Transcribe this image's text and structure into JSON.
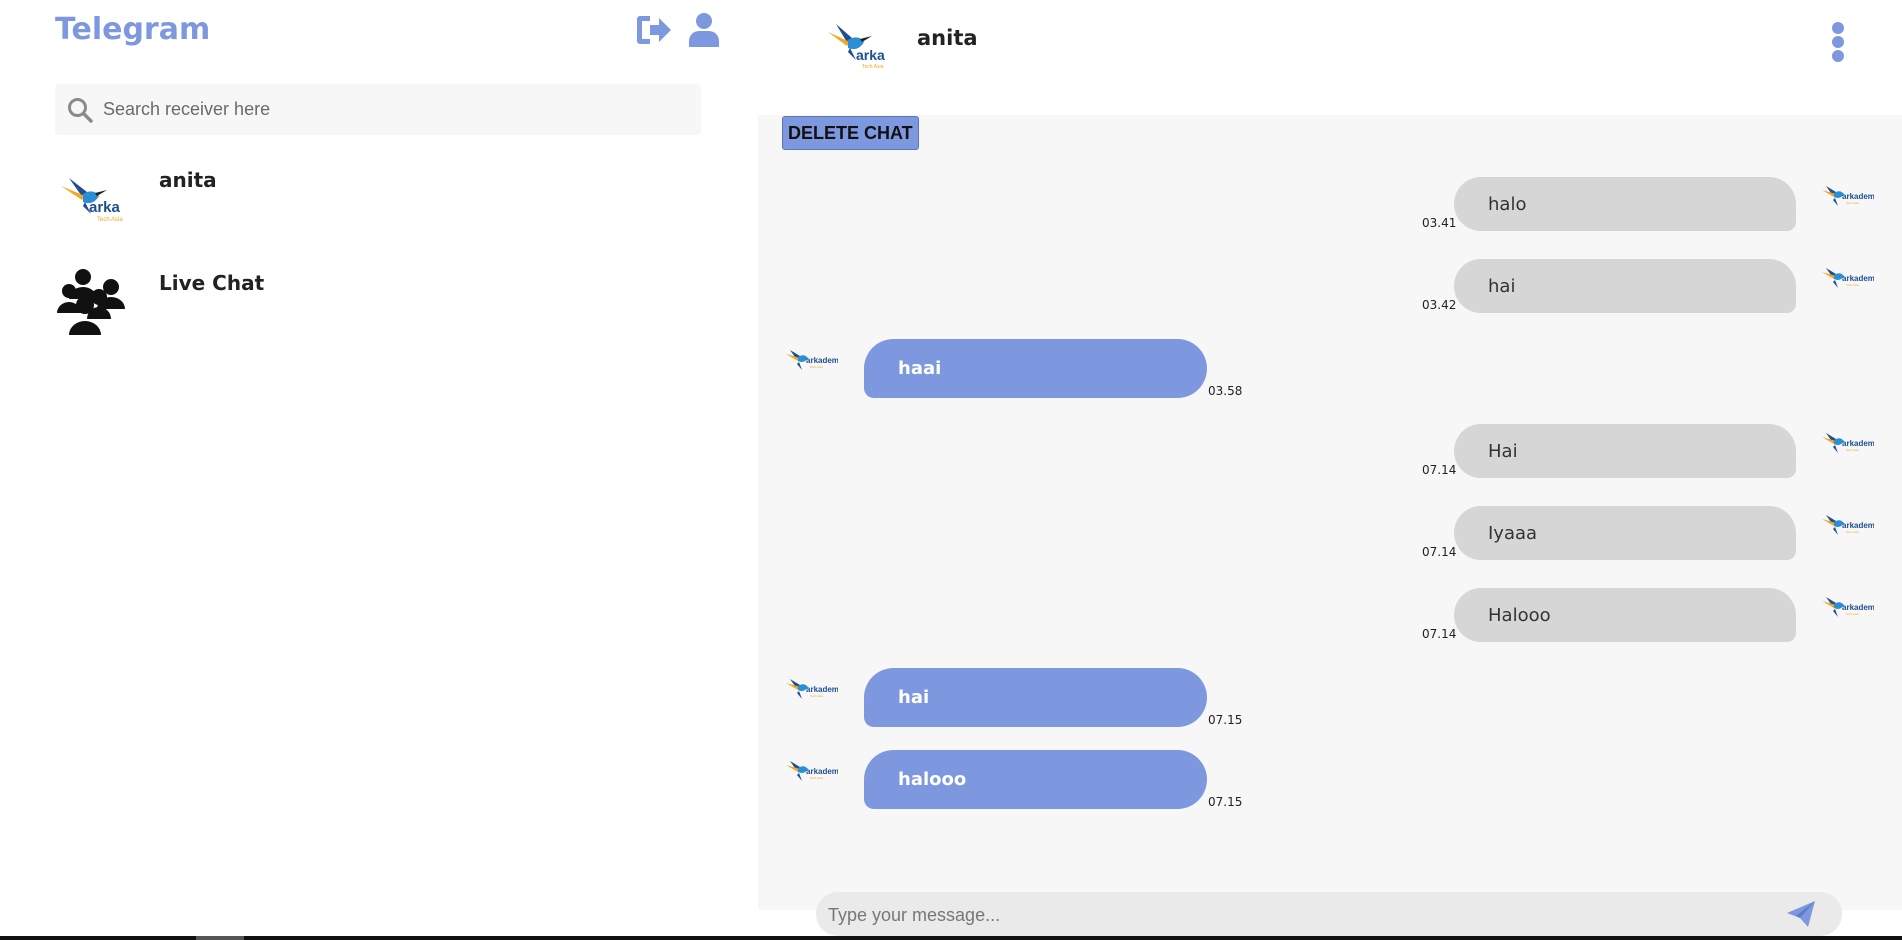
{
  "sidebar": {
    "title": "Telegram",
    "icons": [
      "logout-icon",
      "profile-icon"
    ],
    "search": {
      "placeholder": "Search receiver here",
      "value": ""
    },
    "contacts": [
      {
        "name": "anita",
        "avatar": "arkademy-logo"
      },
      {
        "name": "Live Chat",
        "avatar": "group-icon"
      }
    ]
  },
  "header": {
    "name": "anita",
    "menu_icon": "kebab-menu-icon"
  },
  "chat": {
    "delete_label": "DELETE CHAT",
    "messages": [
      {
        "direction": "out",
        "text": "halo",
        "time": "03.41"
      },
      {
        "direction": "out",
        "text": "hai",
        "time": "03.42"
      },
      {
        "direction": "in",
        "text": "haai",
        "time": "03.58"
      },
      {
        "direction": "out",
        "text": "Hai",
        "time": "07.14"
      },
      {
        "direction": "out",
        "text": "Iyaaa",
        "time": "07.14"
      },
      {
        "direction": "out",
        "text": "Halooo",
        "time": "07.14"
      },
      {
        "direction": "in",
        "text": "hai",
        "time": "07.15"
      },
      {
        "direction": "in",
        "text": "halooo",
        "time": "07.15"
      }
    ]
  },
  "logo": {
    "text": "arka",
    "full_text": "arkademy",
    "tagline": "Tech Asia"
  },
  "composer": {
    "placeholder": "Type your message...",
    "value": "",
    "send_icon": "send-icon"
  },
  "colors": {
    "accent": "#7e98df",
    "outgoing_bubble": "#d6d6d6",
    "chat_bg": "#f7f7f7"
  }
}
